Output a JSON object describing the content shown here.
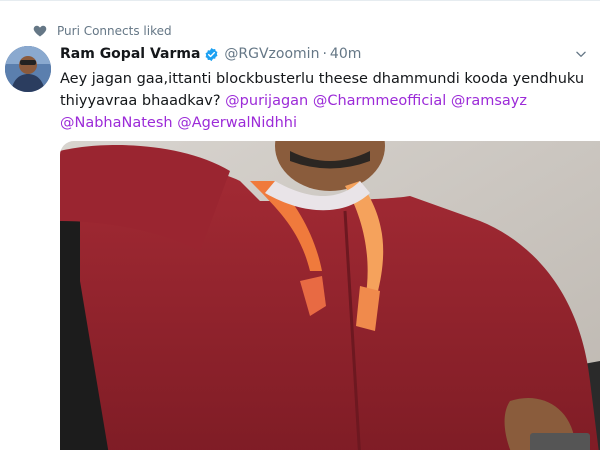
{
  "social_context": {
    "icon": "heart-icon",
    "label": "Puri Connects liked"
  },
  "author": {
    "name": "Ram Gopal Varma",
    "handle": "@RGVzoomin",
    "separator": "·",
    "time": "40m",
    "verified_icon": "verified-badge-icon",
    "verified_color": "#1da1f2"
  },
  "tweet": {
    "text_plain": "Aey jagan gaa,ittanti blockbusterlu theese dhammundi kooda yendhuku thiyyavraa bhaadkav? ",
    "mentions": [
      "@purijagan",
      "@Charmmeofficial",
      "@ramsayz",
      "@NabhaNatesh",
      "@AgerwalNidhhi"
    ],
    "mention_color": "#9c2bd8"
  },
  "media": {
    "alt": "photo"
  },
  "colors": {
    "text_primary": "#14171a",
    "text_secondary": "#657786"
  }
}
